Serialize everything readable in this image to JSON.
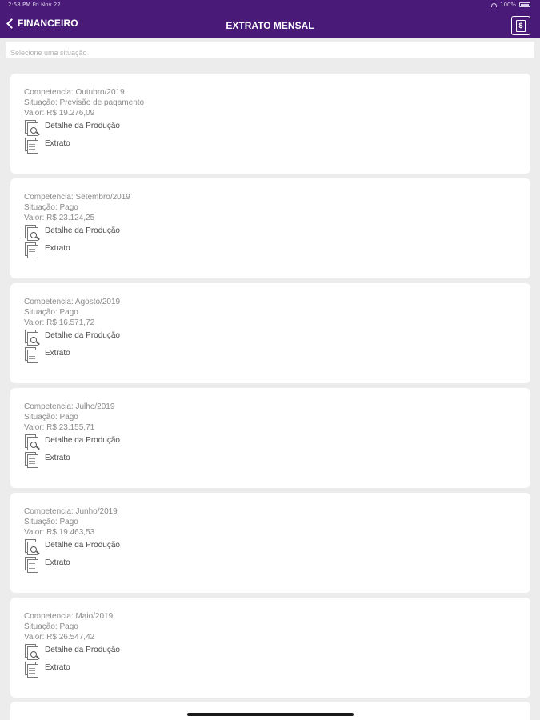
{
  "status_bar": {
    "time": "2:58 PM",
    "date": "Fri Nov 22",
    "battery": "100%"
  },
  "header": {
    "back_label": "FINANCEIRO",
    "title": "EXTRATO MENSAL"
  },
  "search": {
    "placeholder": "Selecione uma situação"
  },
  "cards": [
    {
      "competencia": "Competencia: Outubro/2019",
      "situacao": "Situação: Previsão de pagamento",
      "valor": "Valor: R$ 19.276,09",
      "detail_label": "Detalhe da Produção",
      "extrato_label": "Extrato"
    },
    {
      "competencia": "Competencia: Setembro/2019",
      "situacao": "Situação: Pago",
      "valor": "Valor: R$ 23.124,25",
      "detail_label": "Detalhe da Produção",
      "extrato_label": "Extrato"
    },
    {
      "competencia": "Competencia: Agosto/2019",
      "situacao": "Situação: Pago",
      "valor": "Valor: R$ 16.571,72",
      "detail_label": "Detalhe da Produção",
      "extrato_label": "Extrato"
    },
    {
      "competencia": "Competencia: Julho/2019",
      "situacao": "Situação: Pago",
      "valor": "Valor: R$ 23.155,71",
      "detail_label": "Detalhe da Produção",
      "extrato_label": "Extrato"
    },
    {
      "competencia": "Competencia: Junho/2019",
      "situacao": "Situação: Pago",
      "valor": "Valor: R$ 19.463,53",
      "detail_label": "Detalhe da Produção",
      "extrato_label": "Extrato"
    },
    {
      "competencia": "Competencia: Maio/2019",
      "situacao": "Situação: Pago",
      "valor": "Valor: R$ 26.547,42",
      "detail_label": "Detalhe da Produção",
      "extrato_label": "Extrato"
    }
  ],
  "colors": {
    "header_bg": "#4a1a78",
    "page_bg": "#ececec",
    "card_bg": "#ffffff"
  },
  "icons": {
    "back": "chevron-left-icon",
    "receipt": "receipt-icon",
    "detail": "document-search-icon",
    "extrato": "document-icon"
  }
}
